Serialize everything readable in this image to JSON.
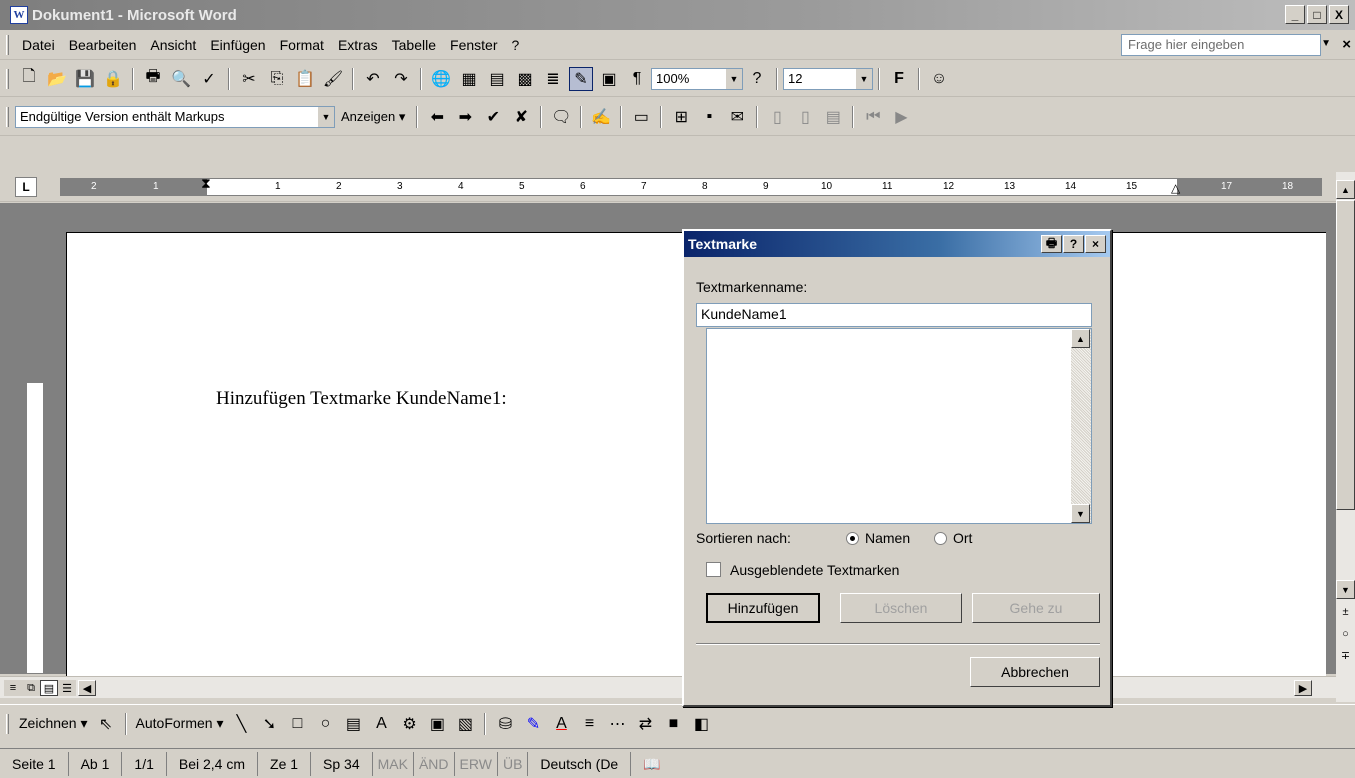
{
  "window": {
    "title": "Dokument1 - Microsoft Word",
    "min": "_",
    "max": "□",
    "close": "X"
  },
  "menu": {
    "items": [
      "Datei",
      "Bearbeiten",
      "Ansicht",
      "Einfügen",
      "Format",
      "Extras",
      "Tabelle",
      "Fenster",
      "?"
    ],
    "ask_placeholder": "Frage hier eingeben"
  },
  "toolbar1": {
    "zoom": "100%",
    "font_size": "12",
    "bold": "F"
  },
  "toolbar2": {
    "markup_view": "Endgültige Version enthält Markups",
    "show_label": "Anzeigen"
  },
  "ruler": {
    "numbers": [
      "2",
      "1",
      "1",
      "2",
      "3",
      "4",
      "5",
      "6",
      "7",
      "8",
      "9",
      "10",
      "11",
      "12",
      "13",
      "14",
      "15",
      "17",
      "18"
    ]
  },
  "document": {
    "text": "Hinzufügen Textmarke KundeName1:"
  },
  "dialog": {
    "title": "Textmarke",
    "name_label": "Textmarkenname:",
    "name_value": "KundeName1",
    "sort_label": "Sortieren nach:",
    "sort_name": "Namen",
    "sort_location": "Ort",
    "hidden_label": "Ausgeblendete Textmarken",
    "add_button": "Hinzufügen",
    "delete_button": "Löschen",
    "goto_button": "Gehe zu",
    "cancel_button": "Abbrechen"
  },
  "drawbar": {
    "draw_label": "Zeichnen",
    "autoshapes_label": "AutoFormen"
  },
  "status": {
    "page": "Seite 1",
    "section": "Ab 1",
    "pages": "1/1",
    "position": "Bei 2,4 cm",
    "line": "Ze 1",
    "column": "Sp 34",
    "mak": "MAK",
    "aend": "ÄND",
    "erw": "ERW",
    "ueb": "ÜB",
    "language": "Deutsch (De"
  }
}
